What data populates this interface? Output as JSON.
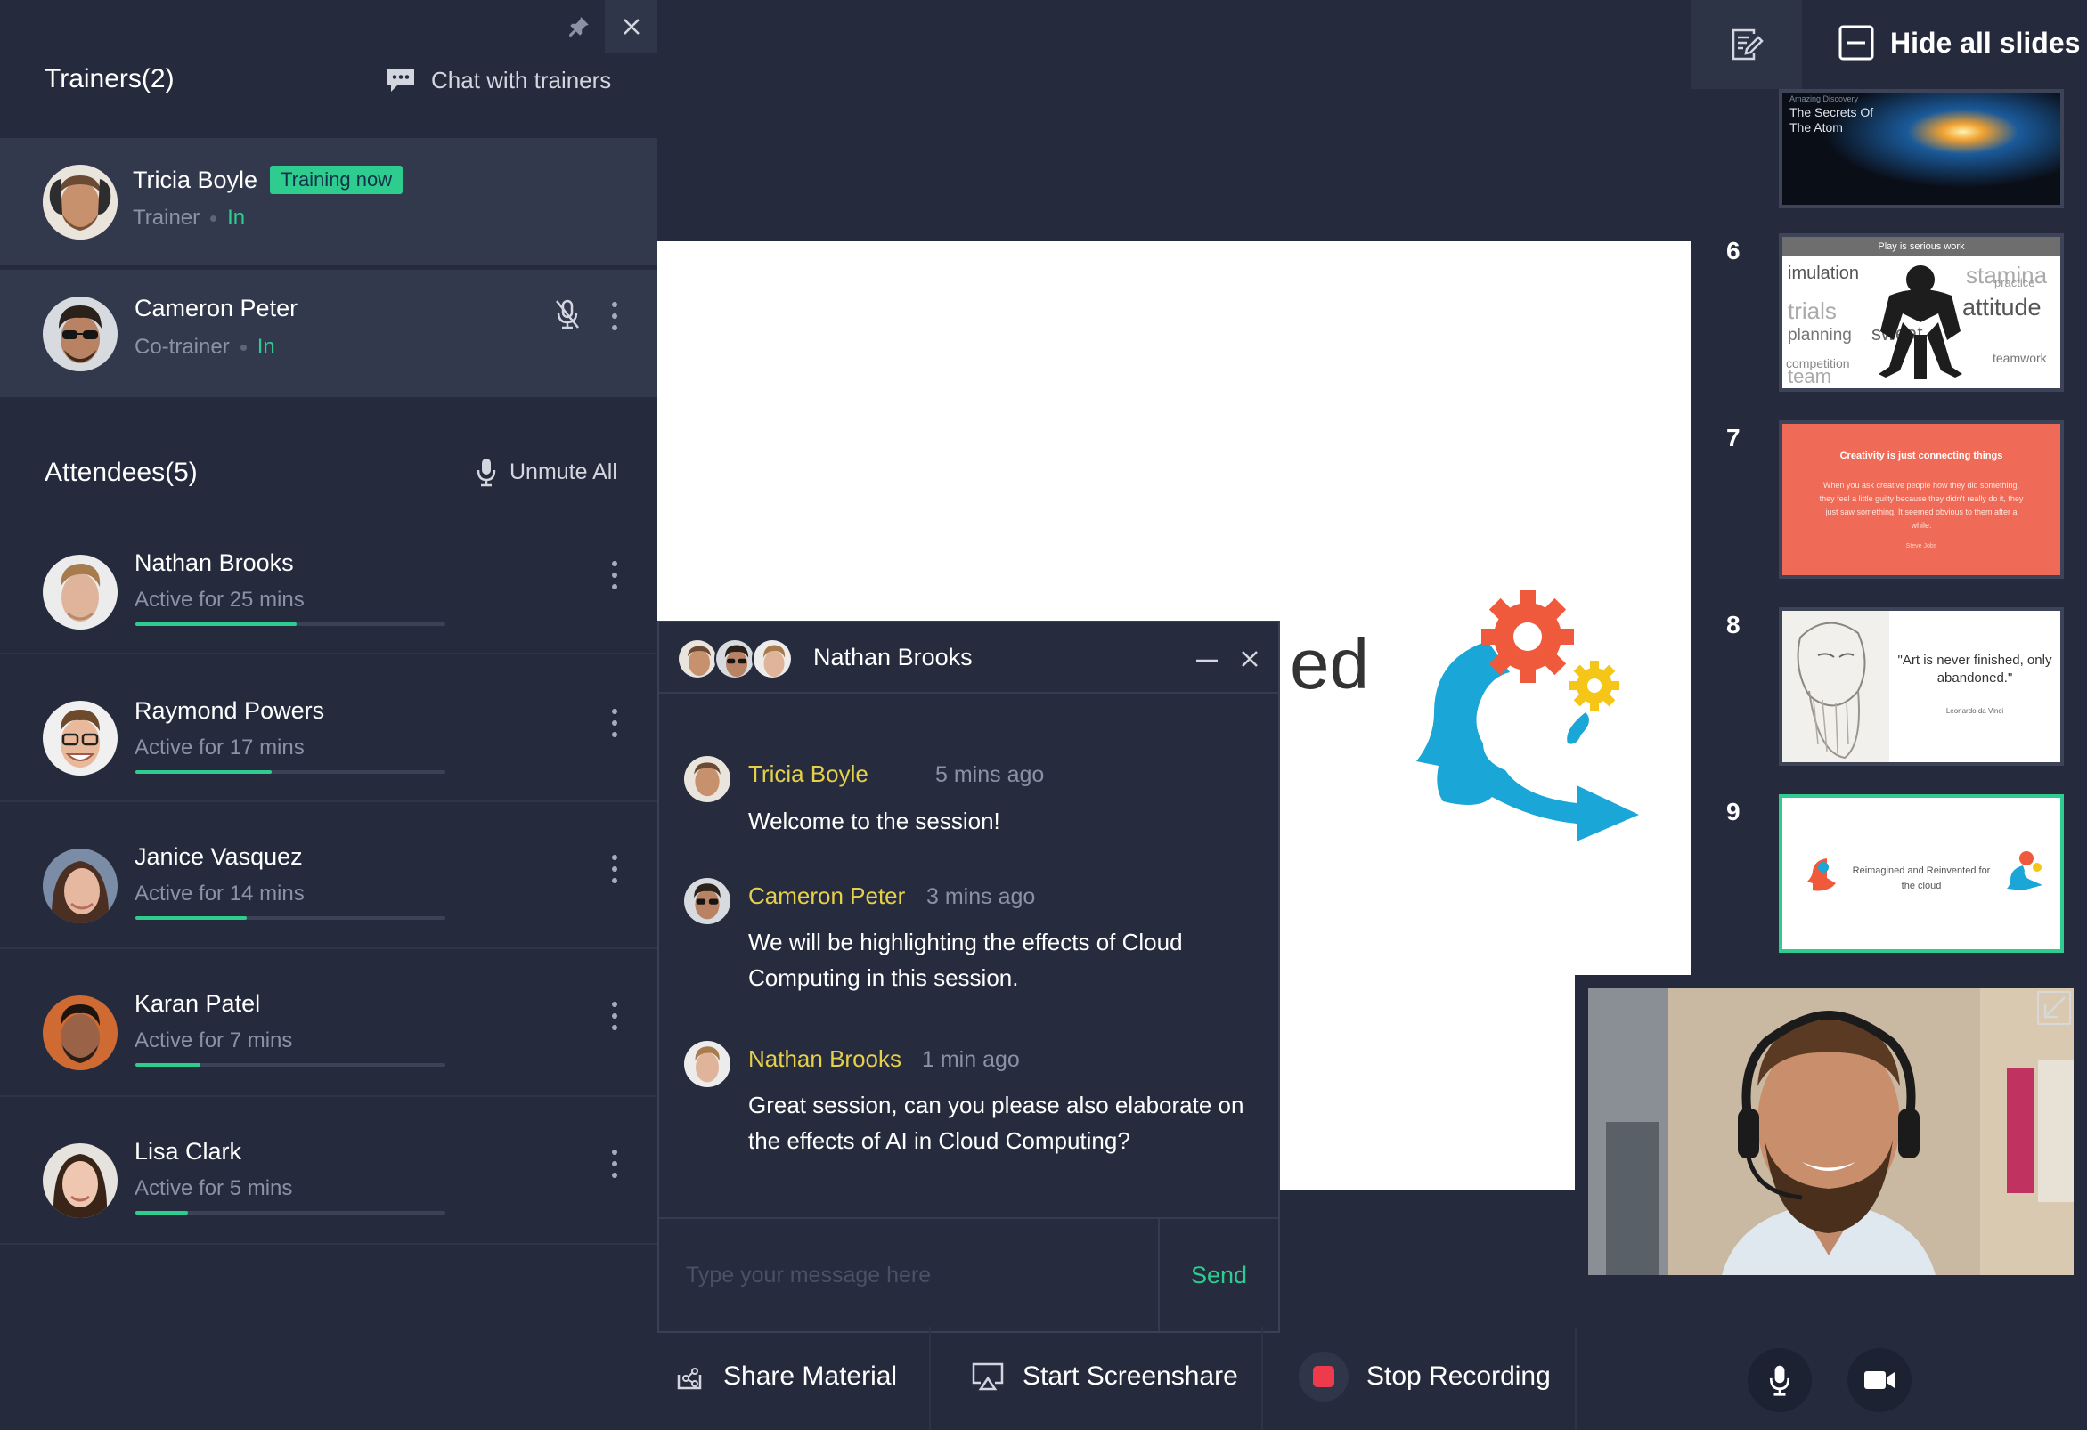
{
  "left_panel": {
    "trainers_title": "Trainers(2)",
    "chat_with_trainers": "Chat with trainers",
    "trainers": [
      {
        "name": "Tricia Boyle",
        "role": "Trainer",
        "status": "In",
        "badge": "Training now"
      },
      {
        "name": "Cameron Peter",
        "role": "Co-trainer",
        "status": "In"
      }
    ],
    "attendees_title": "Attendees(5)",
    "unmute_all": "Unmute All",
    "attendees": [
      {
        "name": "Nathan Brooks",
        "activity": "Active for 25 mins",
        "progress": 0.52
      },
      {
        "name": "Raymond Powers",
        "activity": "Active for 17 mins",
        "progress": 0.44
      },
      {
        "name": "Janice Vasquez",
        "activity": "Active for 14 mins",
        "progress": 0.36
      },
      {
        "name": "Karan Patel",
        "activity": "Active for 7 mins",
        "progress": 0.21
      },
      {
        "name": "Lisa Clark",
        "activity": "Active for 5 mins",
        "progress": 0.17
      }
    ]
  },
  "chat": {
    "title": "Nathan Brooks",
    "messages": [
      {
        "author": "Tricia Boyle",
        "time": "5 mins ago",
        "text": "Welcome to the session!"
      },
      {
        "author": "Cameron Peter",
        "time": "3 mins ago",
        "text": "We will be highlighting the effects of Cloud Computing in this session."
      },
      {
        "author": "Nathan Brooks",
        "time": "1 min ago",
        "text": "Great session, can you please also elaborate on the effects of AI in Cloud Computing?"
      }
    ],
    "input_placeholder": "Type your message here",
    "send_label": "Send"
  },
  "stage": {
    "slide_partial_text": "ed"
  },
  "toolbar": {
    "share_material": "Share Material",
    "start_screenshare": "Start Screenshare",
    "stop_recording": "Stop Recording"
  },
  "slides_panel": {
    "hide_all_slides": "Hide all slides",
    "slides": [
      {
        "number": "",
        "kicker": "Amazing Discovery",
        "title": "The Secrets Of The Atom"
      },
      {
        "number": "6",
        "title": "Play is serious work",
        "words": [
          "imulation",
          "stamina",
          "trials",
          "attitude",
          "planning",
          "sweat",
          "competition",
          "teamwork",
          "team",
          "practice"
        ]
      },
      {
        "number": "7",
        "title": "Creativity is just connecting things",
        "body": "When you ask creative people how they did something, they feel a little guilty because they didn't really do it, they just saw something. It seemed obvious to them after a while.",
        "attribution": "Steve Jobs"
      },
      {
        "number": "8",
        "quote": "\"Art is never finished, only abandoned.\"",
        "attribution": "Leonardo da Vinci"
      },
      {
        "number": "9",
        "title": "Reimagined and Reinvented for the cloud",
        "active": true
      }
    ]
  },
  "colors": {
    "background": "#252b3d",
    "accent_green": "#2ecc8f",
    "author_yellow": "#e5d04a",
    "record_red": "#ee3b4b"
  }
}
